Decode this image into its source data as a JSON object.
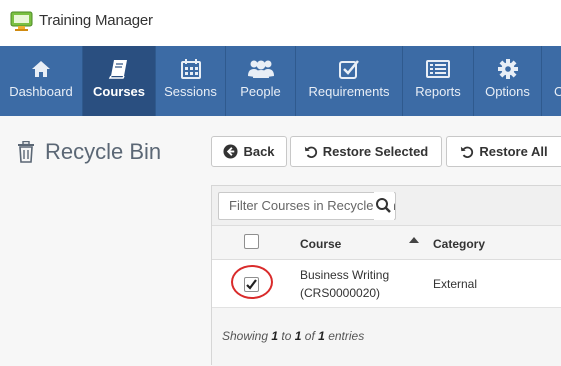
{
  "app": {
    "title": "Training Manager"
  },
  "nav": {
    "items": [
      {
        "label": "Dashboard",
        "icon": "home-icon"
      },
      {
        "label": "Courses",
        "icon": "book-icon",
        "active": true
      },
      {
        "label": "Sessions",
        "icon": "calendar-icon"
      },
      {
        "label": "People",
        "icon": "people-icon"
      },
      {
        "label": "Requirements",
        "icon": "checkbox-icon"
      },
      {
        "label": "Reports",
        "icon": "report-icon"
      },
      {
        "label": "Options",
        "icon": "gear-icon"
      },
      {
        "label": "C",
        "icon": ""
      }
    ]
  },
  "page": {
    "title": "Recycle Bin",
    "icon": "trash-icon"
  },
  "toolbar": {
    "back_label": "Back",
    "restore_selected_label": "Restore Selected",
    "restore_all_label": "Restore All"
  },
  "filter": {
    "placeholder": "Filter Courses in Recycle Bin"
  },
  "table": {
    "columns": [
      "Course",
      "Category"
    ],
    "rows": [
      {
        "course_line1": "Business Writing",
        "course_line2": "(CRS0000020)",
        "category": "External",
        "checked": true
      }
    ]
  },
  "footer": {
    "showing": "Showing",
    "from": "1",
    "to_word": "to",
    "to": "1",
    "of_word": "of",
    "total": "1",
    "entries": "entries"
  },
  "colors": {
    "nav_bg": "#3c6ba5",
    "nav_active": "#2a4f80",
    "highlight_circle": "#d92b2b"
  }
}
